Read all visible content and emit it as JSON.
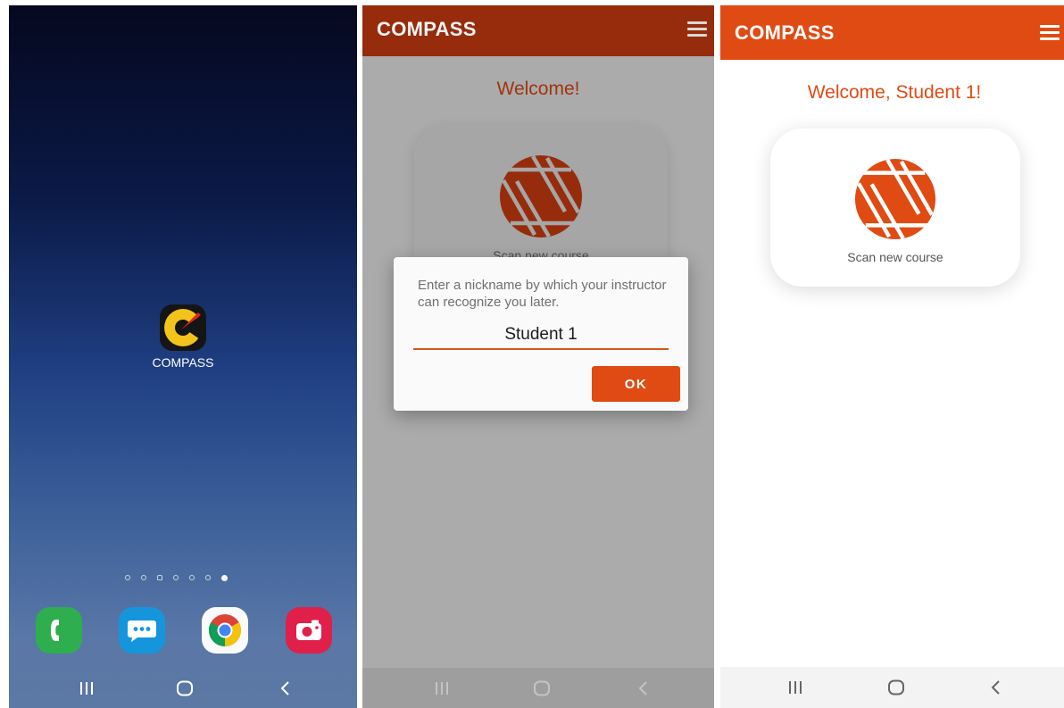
{
  "home_screen": {
    "app_name": "COMPASS",
    "page_dots": 7,
    "active_dot": 7,
    "dock": [
      "phone-icon",
      "messages-icon",
      "chrome-icon",
      "camera-icon"
    ]
  },
  "nickname_screen": {
    "app_title": "COMPASS",
    "welcome": "Welcome!",
    "card_label": "Scan new course",
    "dialog": {
      "message": "Enter a nickname by which your instructor can recognize you later.",
      "input_value": "Student 1",
      "ok_label": "OK"
    }
  },
  "student_screen": {
    "app_title": "COMPASS",
    "welcome": "Welcome, Student 1!",
    "card_label": "Scan new course"
  },
  "nav": {
    "recents": "recents-icon",
    "home": "home-icon",
    "back": "back-icon"
  },
  "colors": {
    "accent": "#e04b13",
    "accent_dimmed": "#962c0c",
    "scrim": "#ababab"
  }
}
